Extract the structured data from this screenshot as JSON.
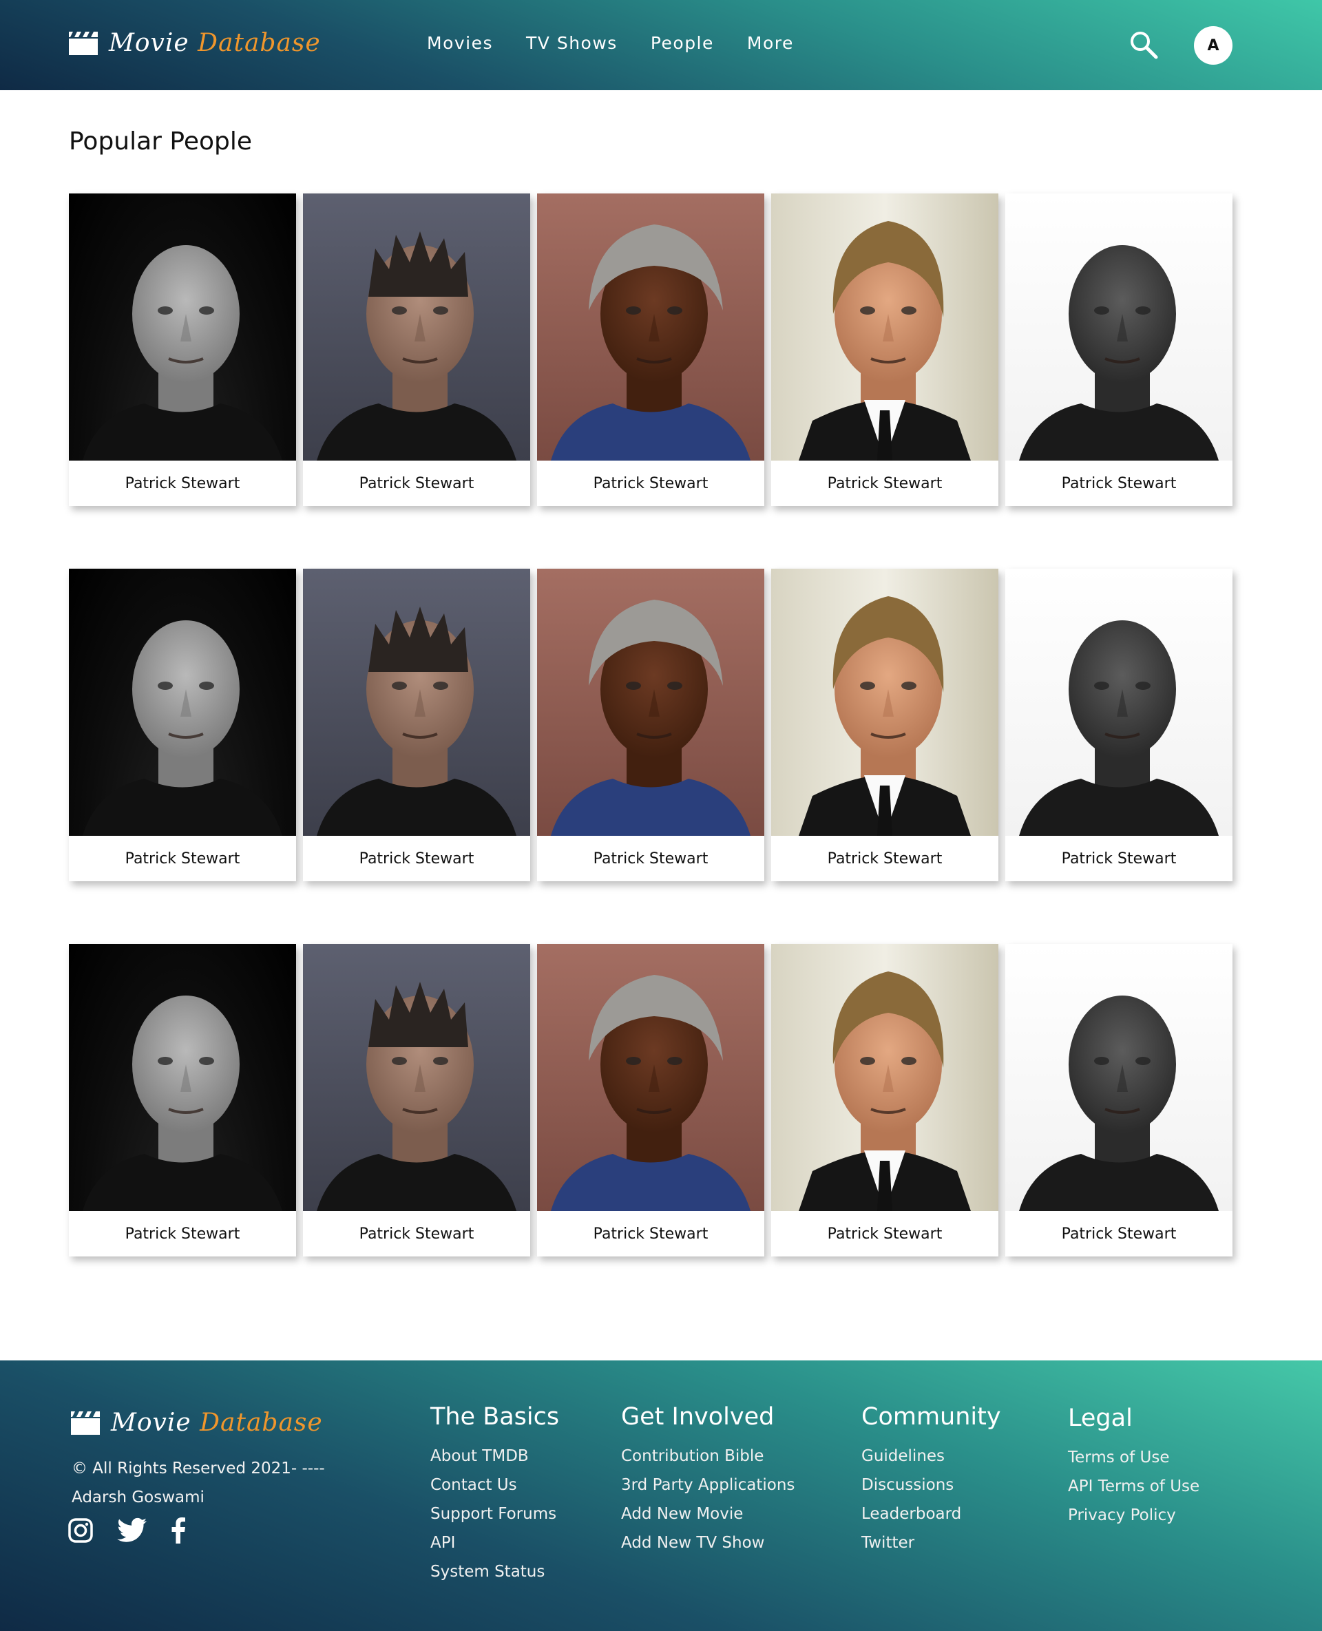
{
  "header": {
    "brand_word1": "Movie",
    "brand_word2": "Database",
    "nav": [
      "Movies",
      "TV Shows",
      "People",
      "More"
    ],
    "avatar_initial": "A"
  },
  "main": {
    "title": "Popular People",
    "rows": [
      [
        {
          "name": "Patrick Stewart",
          "photo": "bald-man-bw-portrait"
        },
        {
          "name": "Patrick Stewart",
          "photo": "spiky-hair-man-portrait"
        },
        {
          "name": "Patrick Stewart",
          "photo": "grey-haired-man-color-portrait"
        },
        {
          "name": "Patrick Stewart",
          "photo": "blond-man-suit-portrait"
        },
        {
          "name": "Patrick Stewart",
          "photo": "bald-man-bw-portrait-bright"
        }
      ],
      [
        {
          "name": "Patrick Stewart",
          "photo": "bald-man-bw-portrait"
        },
        {
          "name": "Patrick Stewart",
          "photo": "spiky-hair-man-portrait"
        },
        {
          "name": "Patrick Stewart",
          "photo": "grey-haired-man-color-portrait"
        },
        {
          "name": "Patrick Stewart",
          "photo": "blond-man-suit-portrait"
        },
        {
          "name": "Patrick Stewart",
          "photo": "bald-man-bw-portrait-bright"
        }
      ],
      [
        {
          "name": "Patrick Stewart",
          "photo": "bald-man-bw-portrait"
        },
        {
          "name": "Patrick Stewart",
          "photo": "spiky-hair-man-portrait"
        },
        {
          "name": "Patrick Stewart",
          "photo": "grey-haired-man-color-portrait"
        },
        {
          "name": "Patrick Stewart",
          "photo": "blond-man-suit-portrait"
        },
        {
          "name": "Patrick Stewart",
          "photo": "bald-man-bw-portrait-bright"
        }
      ]
    ]
  },
  "footer": {
    "copyright_line1": "© All Rights Reserved 2021- ----",
    "copyright_line2": "Adarsh Goswami",
    "social_icons": [
      "instagram-icon",
      "twitter-icon",
      "facebook-icon"
    ],
    "columns": [
      {
        "heading": "The Basics",
        "links": [
          "About TMDB",
          "Contact Us",
          "Support Forums",
          "API",
          "System Status"
        ]
      },
      {
        "heading": "Get Involved",
        "links": [
          "Contribution Bible",
          "3rd Party Applications",
          "Add New Movie",
          "Add New TV Show"
        ]
      },
      {
        "heading": "Community",
        "links": [
          "Guidelines",
          "Discussions",
          "Leaderboard",
          "Twitter"
        ]
      },
      {
        "heading": "Legal",
        "links": [
          "Terms of Use",
          "API Terms of Use",
          "Privacy Policy"
        ]
      }
    ]
  },
  "colors": {
    "accent_orange": "#f0962c",
    "header_gradient_light": "#3fc7a8",
    "header_gradient_dark": "#0f2a45"
  }
}
